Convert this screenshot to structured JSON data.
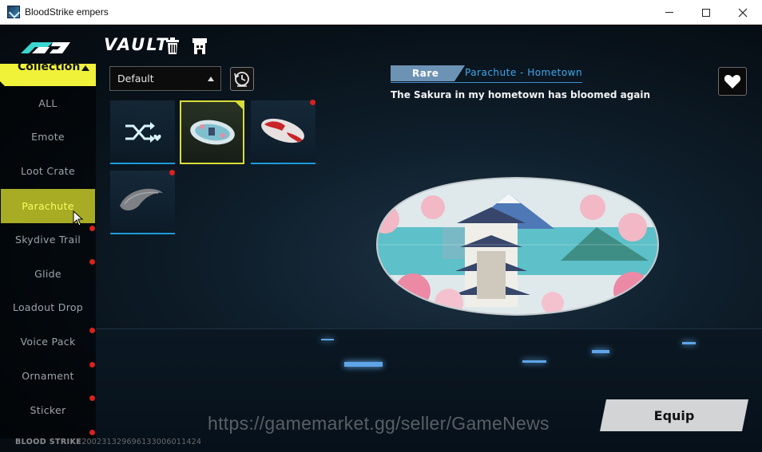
{
  "window": {
    "title": "BloodStrike empers",
    "minimize_icon": "minimize-icon",
    "maximize_icon": "maximize-icon",
    "close_icon": "close-icon"
  },
  "header": {
    "title": "VAULT",
    "icons": [
      "trash-icon",
      "market-icon"
    ]
  },
  "sidebar": {
    "collection_label": "Collection",
    "items": [
      {
        "label": "ALL",
        "active": false,
        "new": false
      },
      {
        "label": "Emote",
        "active": false,
        "new": false
      },
      {
        "label": "Loot Crate",
        "active": false,
        "new": false
      },
      {
        "label": "Parachute",
        "active": true,
        "new": false
      },
      {
        "label": "Skydive Trail",
        "active": false,
        "new": true
      },
      {
        "label": "Glide",
        "active": false,
        "new": true
      },
      {
        "label": "Loadout Drop",
        "active": false,
        "new": false
      },
      {
        "label": "Voice Pack",
        "active": false,
        "new": true
      },
      {
        "label": "Ornament",
        "active": false,
        "new": true
      },
      {
        "label": "Sticker",
        "active": false,
        "new": true
      }
    ]
  },
  "filter": {
    "sort_selected": "Default",
    "history_icon": "history-icon"
  },
  "grid": {
    "items": [
      {
        "kind": "random",
        "icon": "shuffle-heart-icon",
        "selected": false,
        "new": false
      },
      {
        "kind": "parachute-hometown",
        "selected": true,
        "new": false
      },
      {
        "kind": "parachute-red",
        "selected": false,
        "new": true
      },
      {
        "kind": "parachute-grey",
        "selected": false,
        "new": true
      }
    ]
  },
  "detail": {
    "rarity": "Rare",
    "name": "Parachute - Hometown",
    "description": "The Sakura in my hometown has bloomed again",
    "favorite_icon": "heart-icon"
  },
  "actions": {
    "equip_label": "Equip"
  },
  "watermark": "https://gamemarket.gg/seller/GameNews",
  "footer": {
    "brand": "BLOOD STRIKE",
    "id": "1200231329696133006011424"
  },
  "colors": {
    "accent_yellow": "#f0f23a",
    "active_item": "#a8ab24",
    "rarity_blue": "#6d93b4",
    "name_blue": "#3fa9ef",
    "new_dot": "#d8221b"
  }
}
